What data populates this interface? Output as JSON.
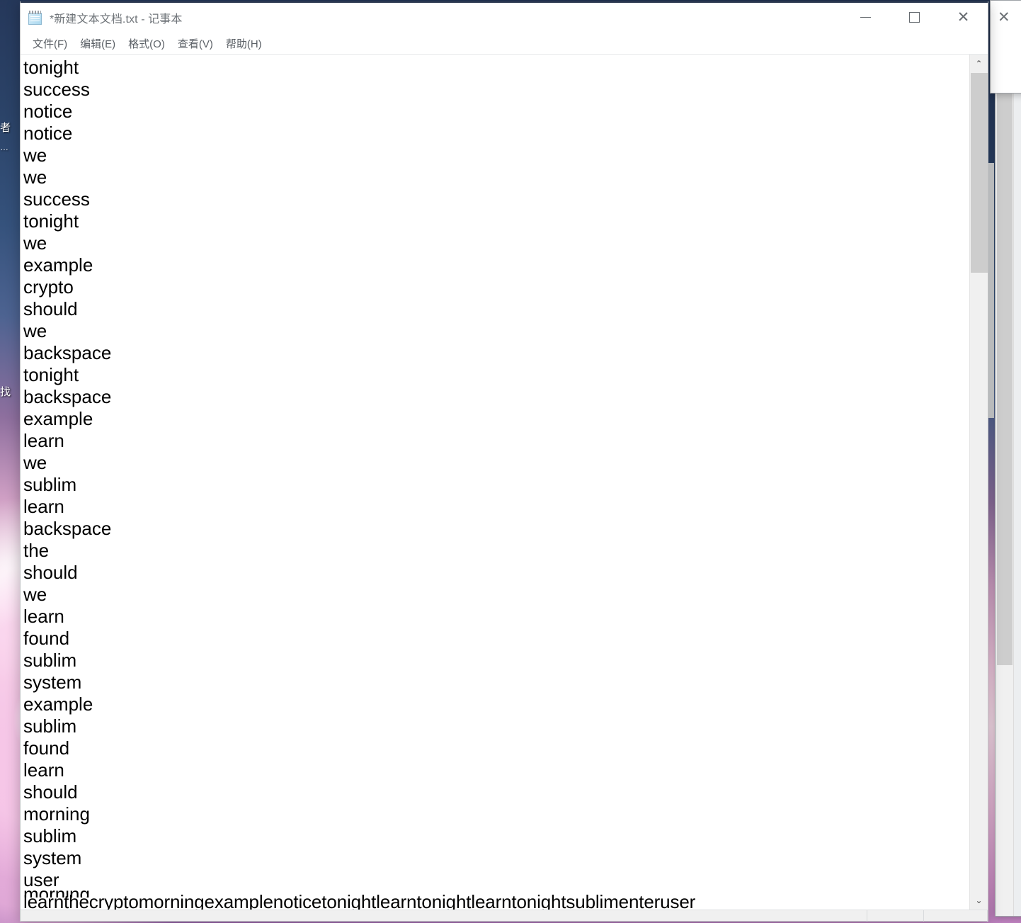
{
  "desktop": {
    "icon_labels": [
      "者",
      "…",
      "找"
    ]
  },
  "background_windows": {
    "far": {
      "close_label": "✕"
    },
    "near": {
      "close_label": "✕",
      "scroll_up_label": "⌃"
    }
  },
  "notepad": {
    "icon_name": "notepad-icon",
    "title": "*新建文本文档.txt - 记事本",
    "caption": {
      "minimize_label": "",
      "maximize_label": "",
      "close_label": "✕"
    },
    "menu": [
      {
        "label": "文件(F)"
      },
      {
        "label": "编辑(E)"
      },
      {
        "label": "格式(O)"
      },
      {
        "label": "查看(V)"
      },
      {
        "label": "帮助(H)"
      }
    ],
    "scrollbar": {
      "up_label": "⌃",
      "down_label": "⌄"
    },
    "status": {
      "cell1": "",
      "cell2": "",
      "cell3": ""
    },
    "document_lines": [
      "tonight",
      "success",
      "notice",
      "notice",
      "we",
      "we",
      "success",
      "tonight",
      "we",
      "example",
      "crypto",
      "should",
      "we",
      "backspace",
      "tonight",
      "backspace",
      "example",
      "learn",
      "we",
      "sublim",
      "learn",
      "backspace",
      "the",
      "should",
      "we",
      "learn",
      "found",
      "sublim",
      "system",
      "example",
      "sublim",
      "found",
      "learn",
      "should",
      "morning",
      "sublim",
      "system",
      "user",
      "learnthecryptomorningexamplenoticetonightlearntonightlearntonightsublimenteruser"
    ],
    "clipped_line": "morning"
  }
}
